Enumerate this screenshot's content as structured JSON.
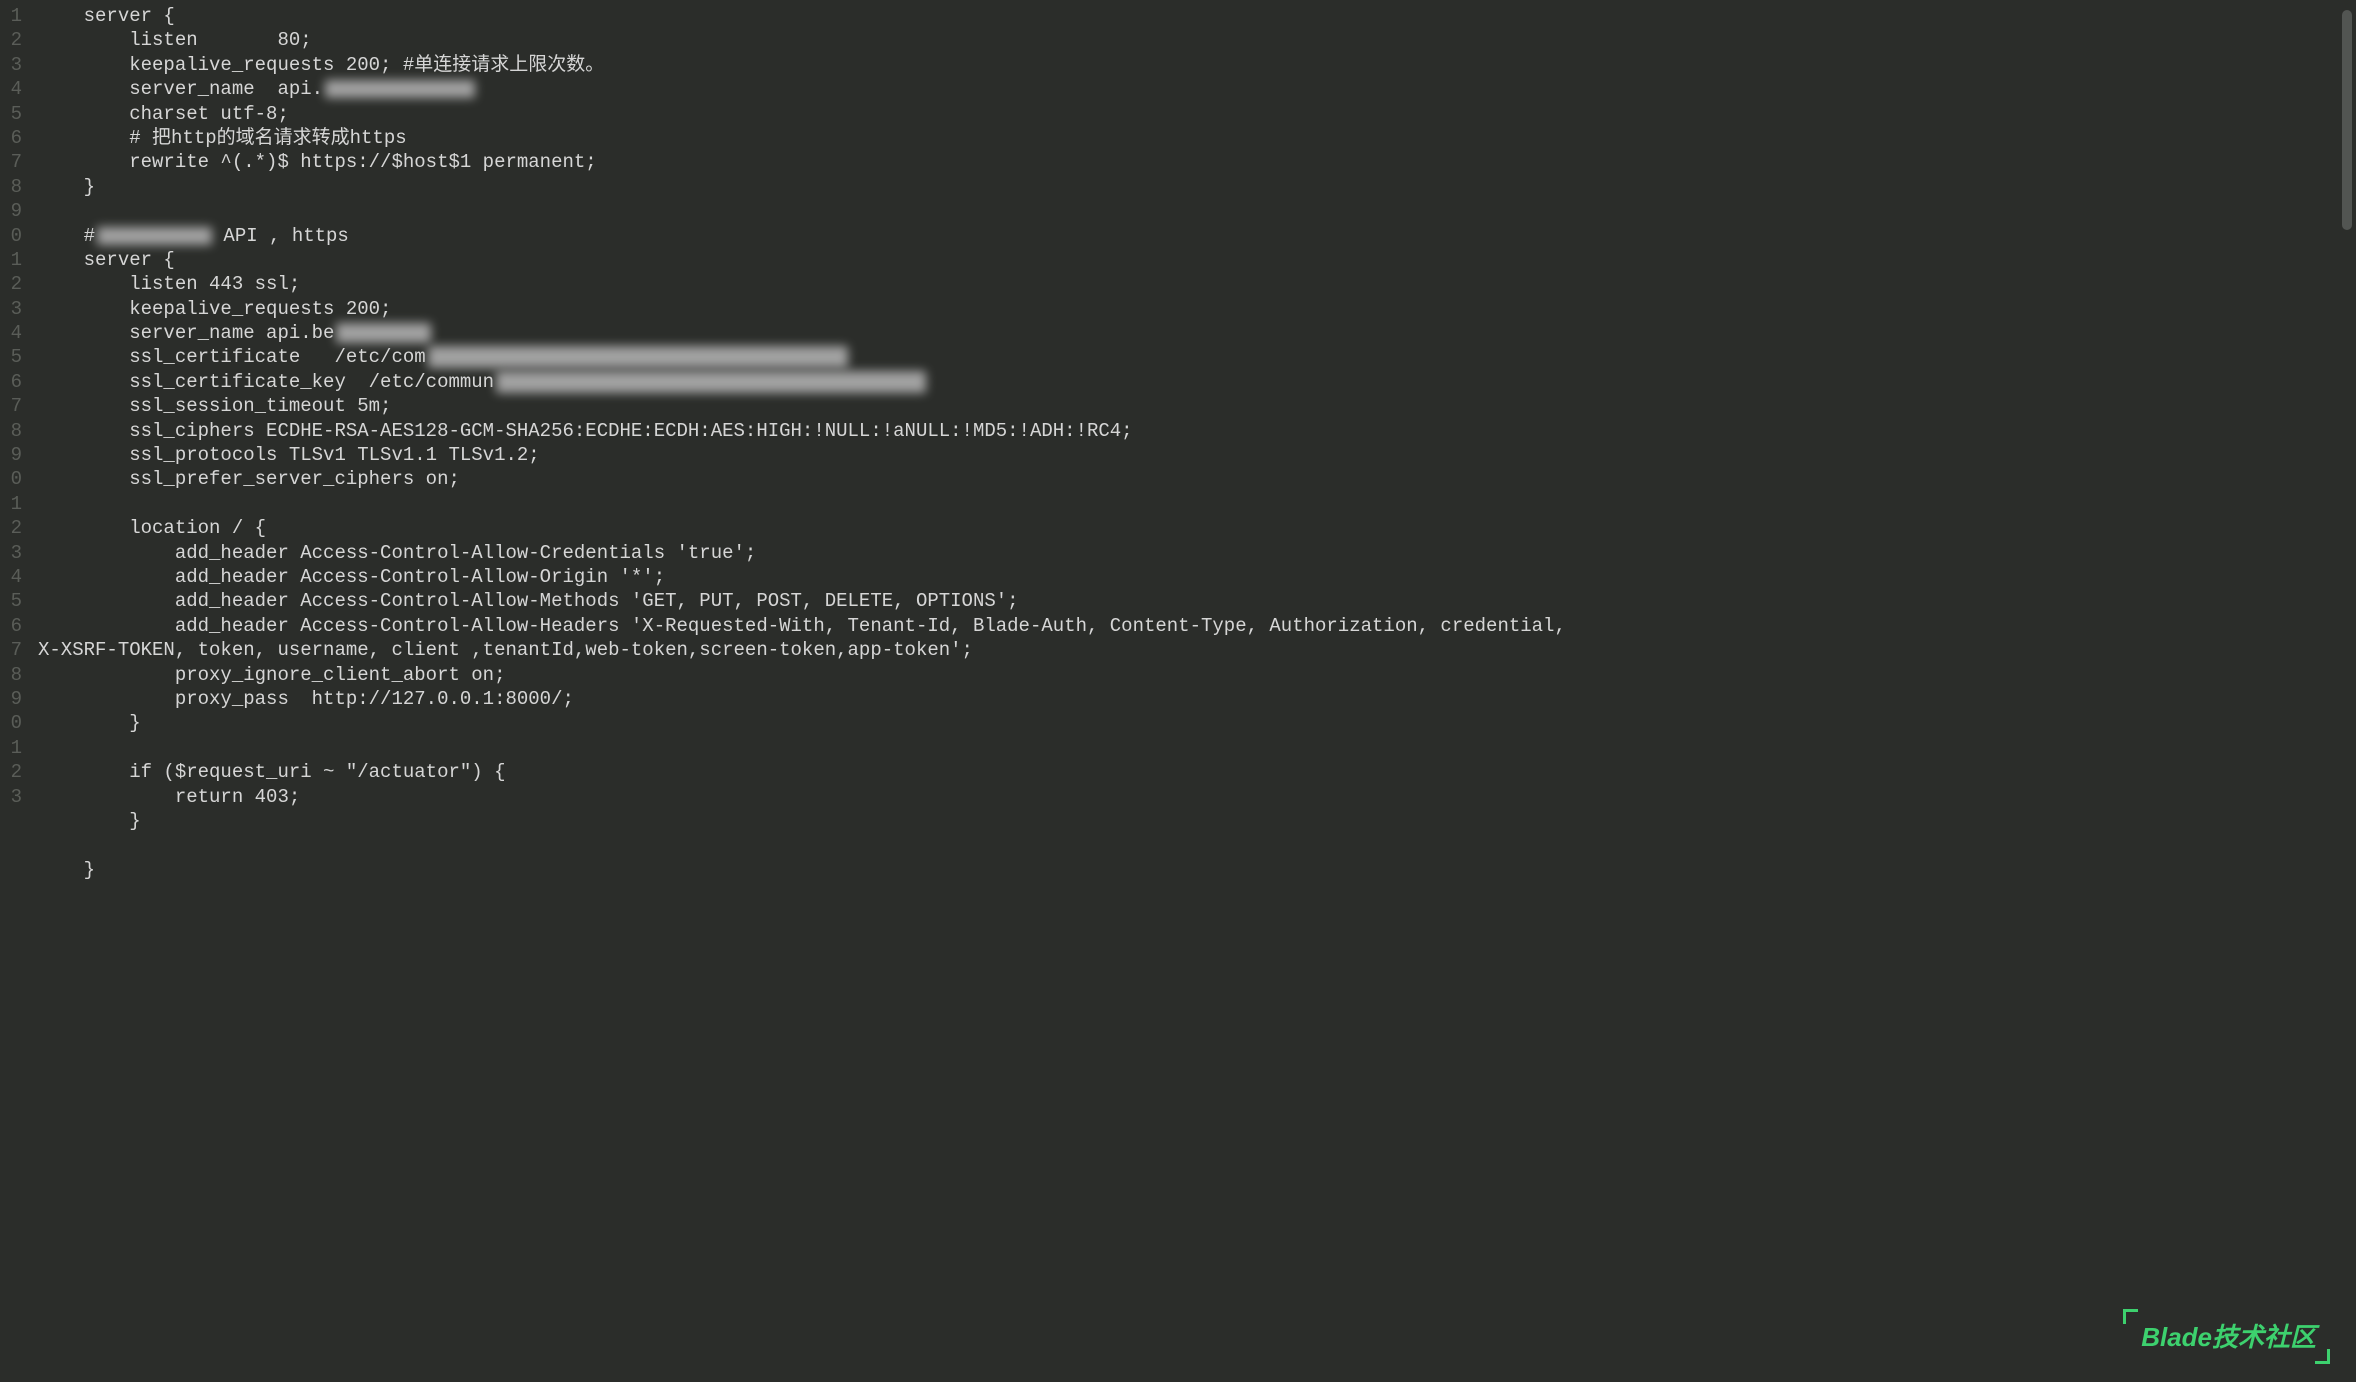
{
  "gutter": {
    "visible_suffixes": [
      "1",
      "2",
      "3",
      "4",
      "5",
      "6",
      "7",
      "8",
      "9",
      "0",
      "1",
      "2",
      "3",
      "4",
      "5",
      "6",
      "7",
      "8",
      "9",
      "0",
      "1",
      "2",
      "3",
      "4",
      "5",
      "6",
      "7",
      "8",
      "9",
      "0",
      "1",
      "2",
      "3"
    ]
  },
  "code": {
    "lines": [
      {
        "text": "    server {"
      },
      {
        "text": "        listen       80;"
      },
      {
        "text": "        keepalive_requests 200; #单连接请求上限次数。"
      },
      {
        "text": "        server_name  api.",
        "blur_after": true,
        "blur_width": 150,
        "blur_height": 18
      },
      {
        "text": "        charset utf-8;"
      },
      {
        "text": "        # 把http的域名请求转成https"
      },
      {
        "text": "        rewrite ^(.*)$ https://$host$1 permanent;"
      },
      {
        "text": "    }"
      },
      {
        "text": ""
      },
      {
        "text": "    #",
        "blur_after": true,
        "blur_width": 115,
        "blur_height": 18,
        "suffix": " API , https"
      },
      {
        "text": "    server {"
      },
      {
        "text": "        listen 443 ssl;"
      },
      {
        "text": "        keepalive_requests 200;",
        "trail_blur_width": 40
      },
      {
        "text": "        server_name api.be",
        "blur_after": true,
        "blur_width": 95,
        "blur_height": 20
      },
      {
        "text": "        ssl_certificate   /etc/com",
        "blur_after": true,
        "blur_width": 420,
        "blur_height": 22
      },
      {
        "text": "        ssl_certificate_key  /etc/commun",
        "blur_after": true,
        "blur_width": 430,
        "blur_height": 22
      },
      {
        "text": "        ssl_session_timeout 5m;"
      },
      {
        "text": "        ssl_ciphers ECDHE-RSA-AES128-GCM-SHA256:ECDHE:ECDH:AES:HIGH:!NULL:!aNULL:!MD5:!ADH:!RC4;"
      },
      {
        "text": "        ssl_protocols TLSv1 TLSv1.1 TLSv1.2;"
      },
      {
        "text": "        ssl_prefer_server_ciphers on;"
      },
      {
        "text": ""
      },
      {
        "text": "        location / {"
      },
      {
        "text": "            add_header Access-Control-Allow-Credentials 'true';"
      },
      {
        "text": "            add_header Access-Control-Allow-Origin '*';"
      },
      {
        "text": "            add_header Access-Control-Allow-Methods 'GET, PUT, POST, DELETE, OPTIONS';"
      },
      {
        "text": "            add_header Access-Control-Allow-Headers 'X-Requested-With, Tenant-Id, Blade-Auth, Content-Type, Authorization, credential, X-XSRF-TOKEN, token, username, client ,tenantId,web-token,screen-token,app-token';"
      },
      {
        "text": "            proxy_ignore_client_abort on;"
      },
      {
        "text": "            proxy_pass  http://127.0.0.1:8000/;"
      },
      {
        "text": "        }"
      },
      {
        "text": ""
      },
      {
        "text": "        if ($request_uri ~ \"/actuator\") {"
      },
      {
        "text": "            return 403;"
      },
      {
        "text": "        }"
      },
      {
        "text": ""
      },
      {
        "text": "    }"
      }
    ]
  },
  "watermark": "Blade技术社区"
}
